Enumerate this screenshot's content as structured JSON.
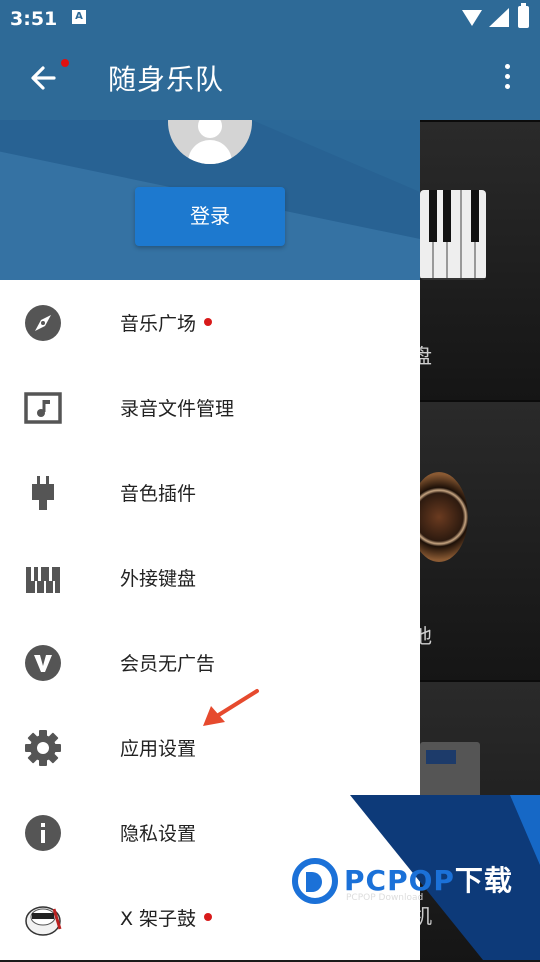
{
  "status_bar": {
    "time": "3:51",
    "notif_glyph": "A"
  },
  "app_bar": {
    "title": "随身乐队"
  },
  "drawer": {
    "login_label": "登录",
    "items": [
      {
        "label": "音乐广场",
        "icon": "compass-icon",
        "badge": true
      },
      {
        "label": "录音文件管理",
        "icon": "music-file-icon",
        "badge": false
      },
      {
        "label": "音色插件",
        "icon": "plugin-icon",
        "badge": false
      },
      {
        "label": "外接键盘",
        "icon": "keyboard-icon",
        "badge": false
      },
      {
        "label": "会员无广告",
        "icon": "vip-icon",
        "badge": false
      },
      {
        "label": "应用设置",
        "icon": "gear-icon",
        "badge": false
      },
      {
        "label": "隐私设置",
        "icon": "info-icon",
        "badge": false
      },
      {
        "label": "X 架子鼓",
        "icon": "drum-app-icon",
        "badge": true
      }
    ]
  },
  "background": {
    "card_labels": [
      "盘",
      "他",
      "机"
    ]
  },
  "watermark": {
    "brand_p": "PCPOP",
    "brand_tail": "下载",
    "sub": "PCPOP Download"
  },
  "colors": {
    "primary": "#2e6a97",
    "button": "#1d79cf",
    "badge": "#d81a1a",
    "arrow": "#e64a2e"
  }
}
